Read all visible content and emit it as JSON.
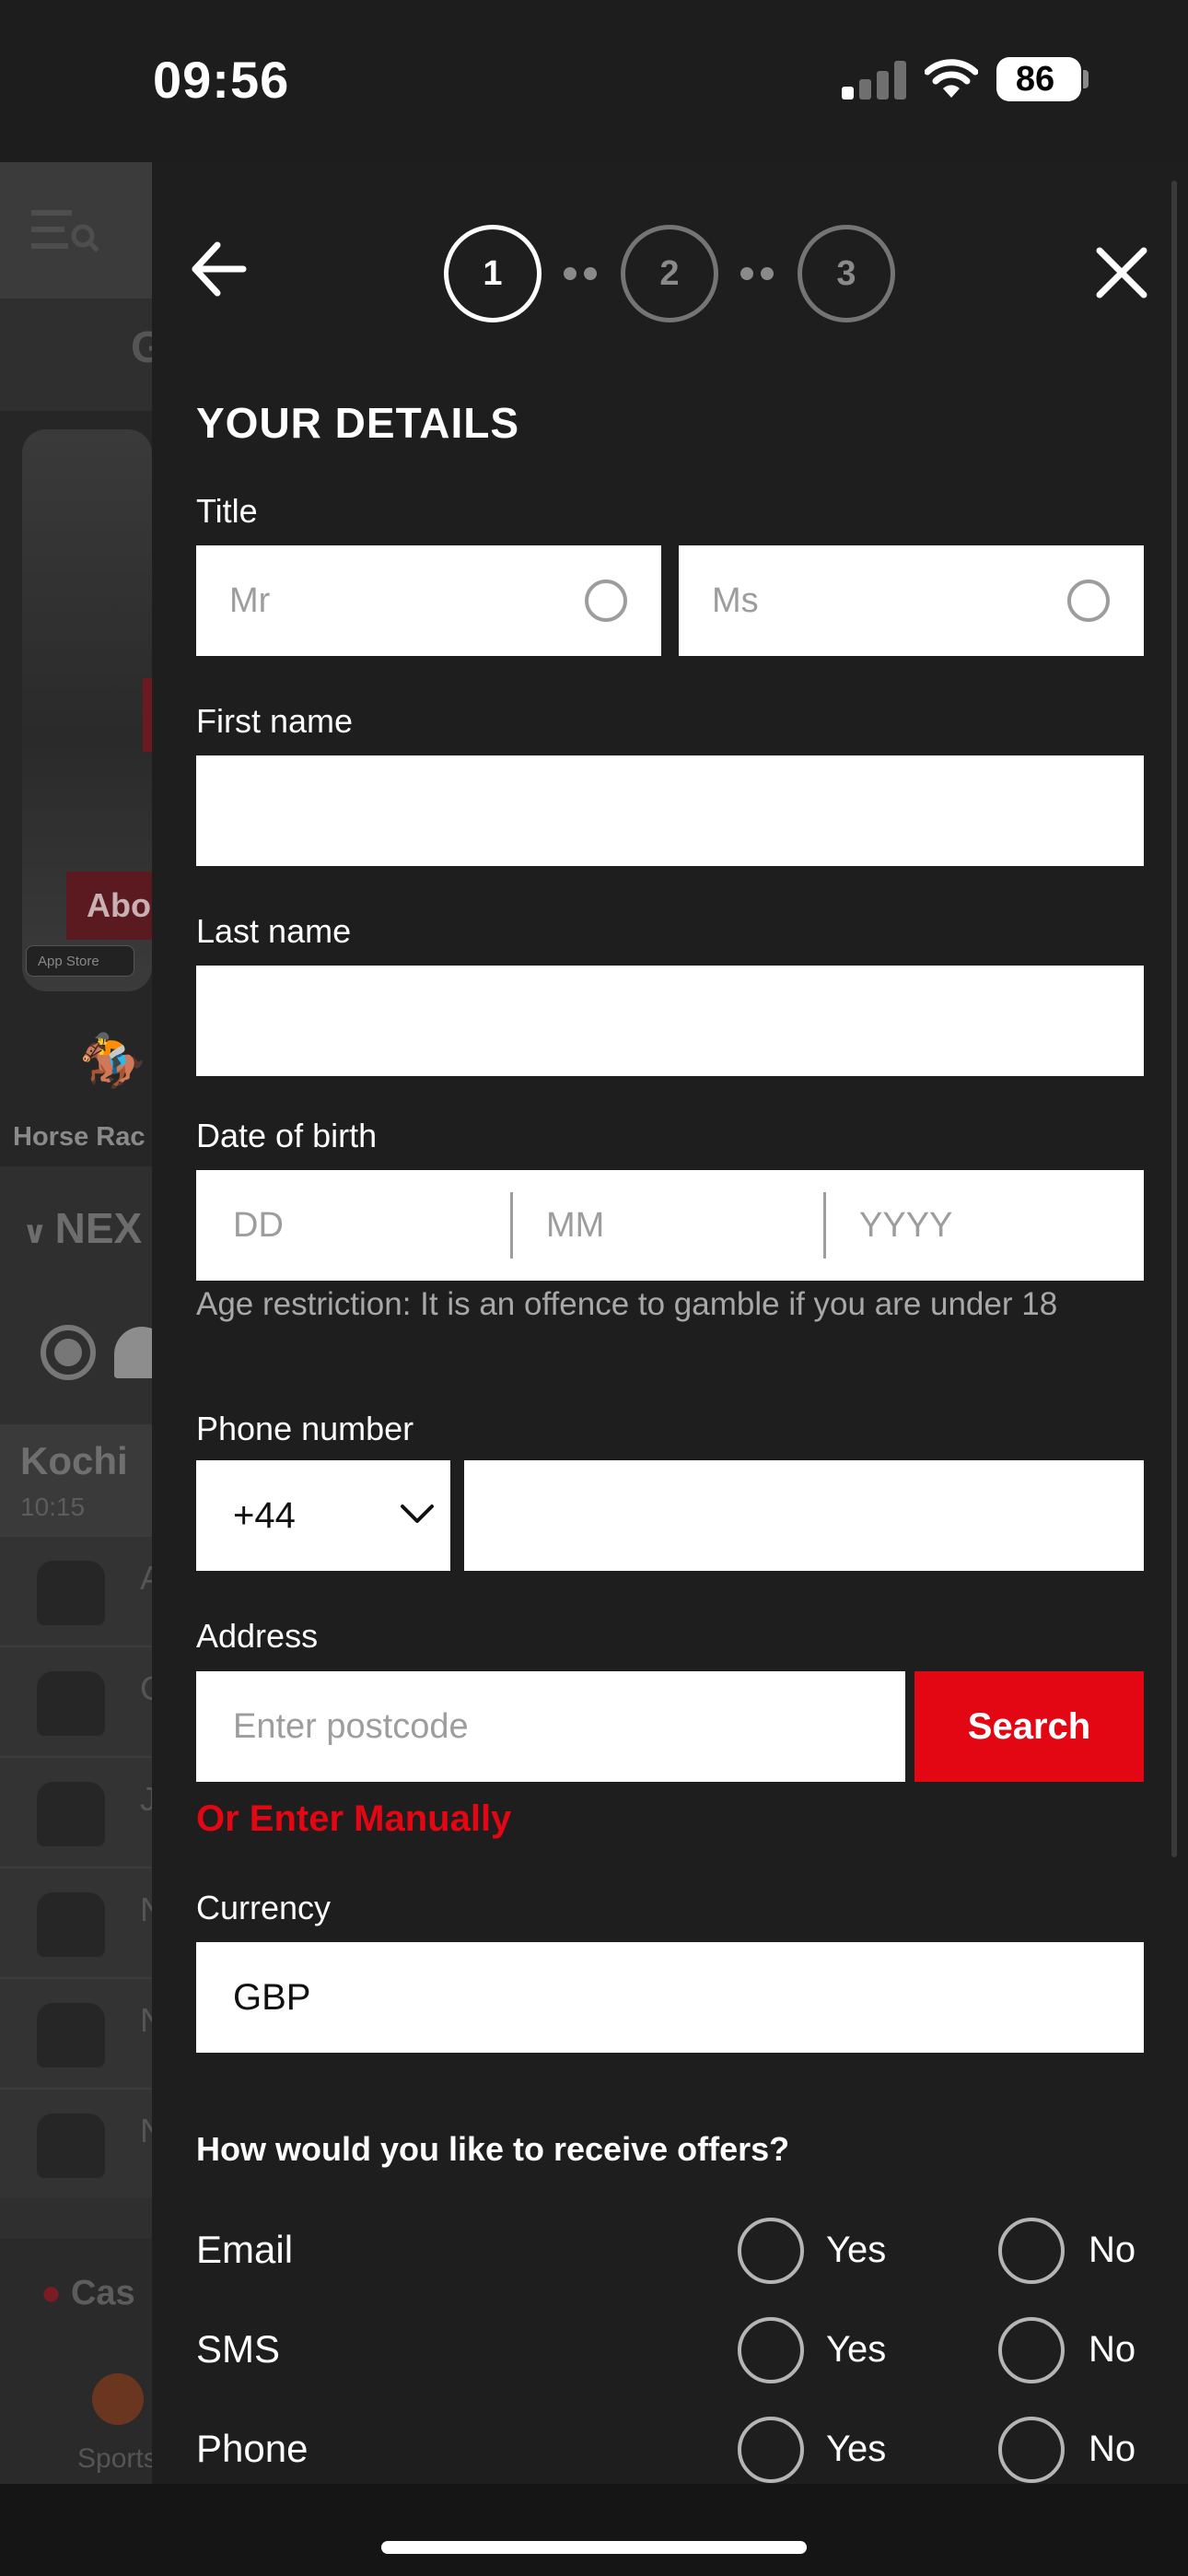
{
  "status_bar": {
    "time": "09:56",
    "battery": "86"
  },
  "background_app": {
    "header_letter": "G",
    "banner_button": "Abo",
    "app_store_badge": "App Store",
    "horse_racing": "Horse Rac",
    "next_races": "NEX",
    "meeting": {
      "name": "Kochi",
      "time": "10:15"
    },
    "runner_letters": [
      "A",
      "C",
      "J",
      "N",
      "N",
      "N"
    ],
    "casino": "Cas",
    "sports": "Sports"
  },
  "stepper": {
    "steps": [
      "1",
      "2",
      "3"
    ],
    "active": 1
  },
  "form": {
    "heading": "YOUR DETAILS",
    "title": {
      "label": "Title",
      "options": [
        "Mr",
        "Ms"
      ]
    },
    "first_name": {
      "label": "First name",
      "value": ""
    },
    "last_name": {
      "label": "Last name",
      "value": ""
    },
    "dob": {
      "label": "Date of birth",
      "day_placeholder": "DD",
      "month_placeholder": "MM",
      "year_placeholder": "YYYY",
      "hint": "Age restriction: It is an offence to gamble if you are under 18"
    },
    "phone": {
      "label": "Phone number",
      "country_code": "+44",
      "value": ""
    },
    "address": {
      "label": "Address",
      "placeholder": "Enter postcode",
      "search_button": "Search",
      "manual_link": "Or Enter Manually"
    },
    "currency": {
      "label": "Currency",
      "value": "GBP"
    },
    "offers": {
      "question": "How would you like to receive offers?",
      "yes_label": "Yes",
      "no_label": "No",
      "channels": [
        "Email",
        "SMS",
        "Phone"
      ]
    }
  },
  "colors": {
    "accent": "#e30613",
    "panel_bg": "#1e1e1e"
  }
}
